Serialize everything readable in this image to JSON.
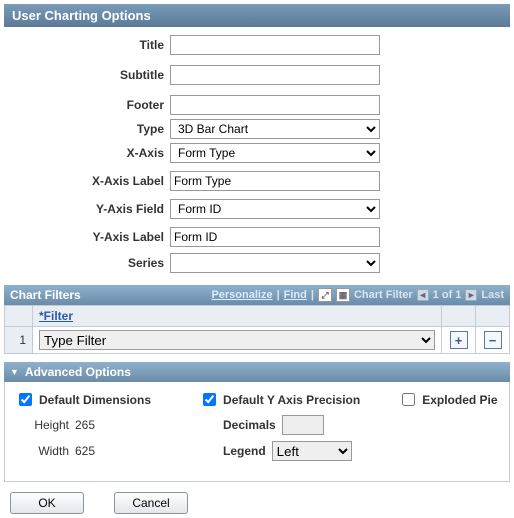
{
  "header": {
    "title": "User Charting Options"
  },
  "form": {
    "title_label": "Title",
    "title_value": "",
    "subtitle_label": "Subtitle",
    "subtitle_value": "",
    "footer_label": "Footer",
    "footer_value": "",
    "type_label": "Type",
    "type_value": "3D Bar Chart",
    "xaxis_label": "X-Axis",
    "xaxis_value": "Form Type",
    "xaxis_lbl_label": "X-Axis Label",
    "xaxis_lbl_value": "Form Type",
    "yaxis_field_label": "Y-Axis Field",
    "yaxis_field_value": "Form ID",
    "yaxis_lbl_label": "Y-Axis Label",
    "yaxis_lbl_value": "Form ID",
    "series_label": "Series",
    "series_value": ""
  },
  "filters": {
    "section_title": "Chart Filters",
    "links": {
      "personalize": "Personalize",
      "find": "Find"
    },
    "pager": {
      "label": "Chart Filter",
      "pos": "1 of 1",
      "last": "Last"
    },
    "header_col": "*Filter",
    "rows": [
      {
        "num": "1",
        "value": "Type Filter"
      }
    ]
  },
  "advanced": {
    "section_title": "Advanced Options",
    "default_dim_label": "Default Dimensions",
    "default_dim_checked": true,
    "default_y_label": "Default Y Axis Precision",
    "default_y_checked": true,
    "exploded_label": "Exploded Pie",
    "exploded_checked": false,
    "height_label": "Height",
    "height_value": "265",
    "width_label": "Width",
    "width_value": "625",
    "decimals_label": "Decimals",
    "decimals_value": "",
    "legend_label": "Legend",
    "legend_value": "Left"
  },
  "buttons": {
    "ok": "OK",
    "cancel": "Cancel"
  }
}
